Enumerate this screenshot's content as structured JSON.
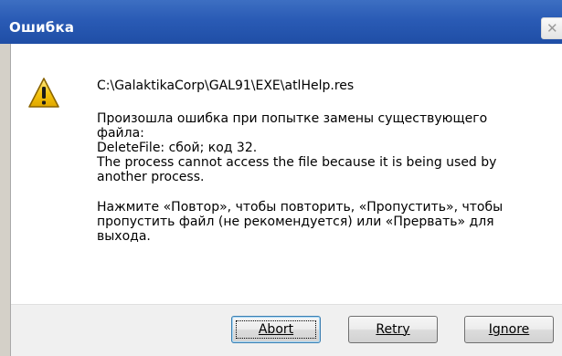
{
  "window": {
    "title": "Ошибка",
    "close_glyph": "✕"
  },
  "icon": "warning-icon",
  "message": {
    "path": "C:\\GalaktikaCorp\\GAL91\\EXE\\atlHelp.res",
    "details": "Произошла ошибка при попытке замены существующего\nфайла:\nDeleteFile: сбой; код 32.\nThe process cannot access the file because it is being used by\nanother process.",
    "instructions": "Нажмите «Повтор», чтобы повторить, «Пропустить», чтобы\nпропустить файл (не рекомендуется) или «Прервать» для\nвыхода."
  },
  "buttons": {
    "abort": "Abort",
    "retry": "Retry",
    "ignore": "Ignore"
  },
  "colors": {
    "titlebar": "#2a5bb5",
    "warning_fill": "#f4c20d",
    "warning_outline": "#8a6400"
  }
}
